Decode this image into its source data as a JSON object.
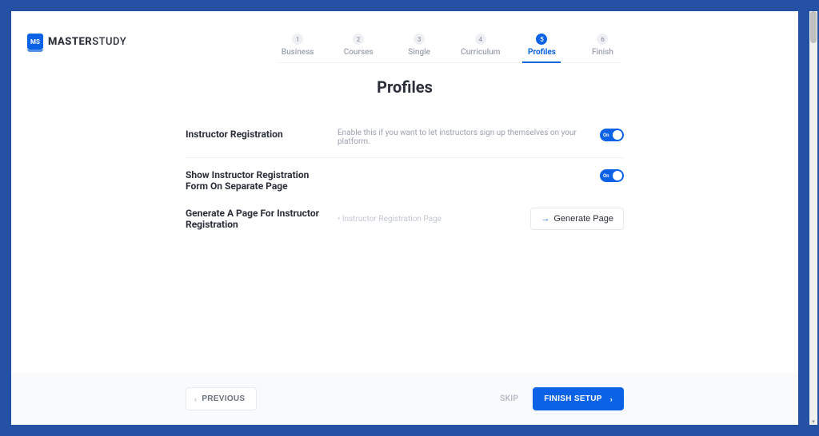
{
  "logo": {
    "icon_text": "MS",
    "brand_bold": "MASTER",
    "brand_light": "STUDY"
  },
  "stepper": [
    {
      "num": "1",
      "label": "Business",
      "active": false
    },
    {
      "num": "2",
      "label": "Courses",
      "active": false
    },
    {
      "num": "3",
      "label": "Single",
      "active": false
    },
    {
      "num": "4",
      "label": "Curriculum",
      "active": false
    },
    {
      "num": "5",
      "label": "Profiles",
      "active": true
    },
    {
      "num": "6",
      "label": "Finish",
      "active": false
    }
  ],
  "page_title": "Profiles",
  "settings": {
    "instructor_registration": {
      "label": "Instructor Registration",
      "desc": "Enable this if you want to let instructors sign up themselves on your platform.",
      "toggle_text": "On"
    },
    "separate_page": {
      "label": "Show Instructor Registration Form On Separate Page",
      "toggle_text": "On"
    },
    "generate": {
      "label": "Generate A Page For Instructor Registration",
      "sub": "Instructor Registration Page",
      "button": "Generate Page"
    }
  },
  "footer": {
    "previous": "PREVIOUS",
    "skip": "SKIP",
    "finish": "FINISH SETUP"
  }
}
